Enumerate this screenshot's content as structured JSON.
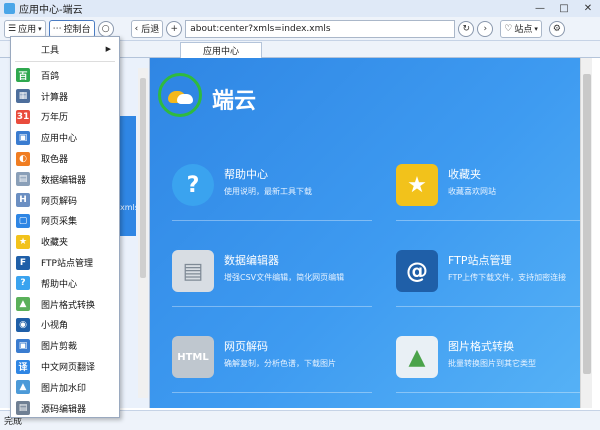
{
  "window": {
    "title": "应用中心-端云",
    "controls": [
      "—",
      "□",
      "✕"
    ]
  },
  "toolbar": {
    "app_menu": "应用",
    "console": "控制台",
    "back": "后退",
    "address": "about:center?xmls=index.xmls",
    "site": "站点"
  },
  "tabs": [
    {
      "label": "应用中心"
    }
  ],
  "brand": {
    "name": "端云"
  },
  "tiles": [
    {
      "title": "帮助中心",
      "desc": "使用说明，最新工具下载",
      "icon": "question-icon",
      "icon_text": "?",
      "color": "#3aa3ef"
    },
    {
      "title": "收藏夹",
      "desc": "收藏喜欢网站",
      "icon": "star-icon",
      "icon_text": "★",
      "color": "#f2c21b"
    },
    {
      "title": "数据编辑器",
      "desc": "增强CSV文件编辑，简化网页编辑",
      "icon": "database-icon",
      "icon_text": "▤",
      "color": "#d8dde3"
    },
    {
      "title": "FTP站点管理",
      "desc": "FTP上传下载文件，支持加密连接",
      "icon": "ftp-icon",
      "icon_text": "@",
      "color": "#1f5fa8"
    },
    {
      "title": "网页解码",
      "desc": "确解复制，分析色谱，下载图片",
      "icon": "html-icon",
      "icon_text": "HTML",
      "color": "#bfc7cf"
    },
    {
      "title": "图片格式转换",
      "desc": "批量转换图片到其它类型",
      "icon": "image-icon",
      "icon_text": "▲",
      "color": "#e9f0f5"
    }
  ],
  "menu": {
    "header": "工具",
    "items": [
      {
        "label": "百鸽",
        "icon": "pigeon-icon",
        "icon_text": "百",
        "color": "#2fa84f"
      },
      {
        "label": "计算器",
        "icon": "calculator-icon",
        "icon_text": "▦",
        "color": "#4d6e9c"
      },
      {
        "label": "万年历",
        "icon": "calendar-icon",
        "icon_text": "31",
        "color": "#e94b3c"
      },
      {
        "label": "应用中心",
        "icon": "app-center-icon",
        "icon_text": "▣",
        "color": "#3a7cd0"
      },
      {
        "label": "取色器",
        "icon": "color-picker-icon",
        "icon_text": "◐",
        "color": "#f07d22"
      },
      {
        "label": "数据编辑器",
        "icon": "data-editor-icon",
        "icon_text": "▤",
        "color": "#8a9fb8"
      },
      {
        "label": "网页解码",
        "icon": "web-decode-icon",
        "icon_text": "H",
        "color": "#6b8fc2"
      },
      {
        "label": "网页采集",
        "icon": "web-collect-icon",
        "icon_text": "▢",
        "color": "#2f86e4"
      },
      {
        "label": "收藏夹",
        "icon": "favorites-icon",
        "icon_text": "★",
        "color": "#f2c21b"
      },
      {
        "label": "FTP站点管理",
        "icon": "ftp-manager-icon",
        "icon_text": "F",
        "color": "#1f5fa8"
      },
      {
        "label": "帮助中心",
        "icon": "help-icon",
        "icon_text": "?",
        "color": "#3aa3ef"
      },
      {
        "label": "图片格式转换",
        "icon": "image-convert-icon",
        "icon_text": "▲",
        "color": "#5ab05a"
      },
      {
        "label": "小视角",
        "icon": "small-view-icon",
        "icon_text": "◉",
        "color": "#1f5fa8"
      },
      {
        "label": "图片剪裁",
        "icon": "image-crop-icon",
        "icon_text": "▣",
        "color": "#3a7cd0"
      },
      {
        "label": "中文网页翻译",
        "icon": "translate-icon",
        "icon_text": "译",
        "color": "#2f86e4"
      },
      {
        "label": "图片加水印",
        "icon": "watermark-icon",
        "icon_text": "▲",
        "color": "#4c9ad8"
      },
      {
        "label": "源码编辑器",
        "icon": "source-editor-icon",
        "icon_text": "▤",
        "color": "#6f7f93"
      }
    ]
  },
  "background_peek": "xmls",
  "status": {
    "text": "完成"
  }
}
